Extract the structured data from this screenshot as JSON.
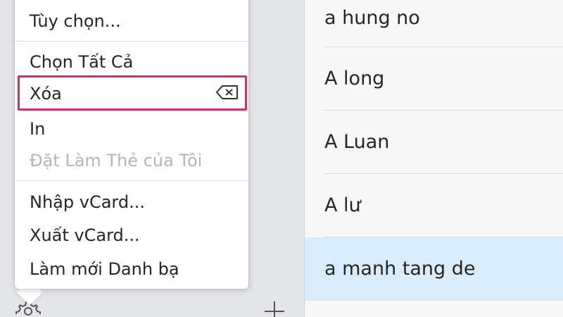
{
  "menu": {
    "items": [
      {
        "label": "Tùy chọn...",
        "enabled": true
      },
      {
        "label": "Chọn Tất Cả",
        "enabled": true
      },
      {
        "label": "Xóa",
        "enabled": true,
        "highlighted": true,
        "shortcut_icon": "delete-key-icon"
      },
      {
        "label": "In",
        "enabled": true
      },
      {
        "label": "Đặt Làm Thẻ của Tôi",
        "enabled": false
      },
      {
        "label": "Nhập vCard...",
        "enabled": true
      },
      {
        "label": "Xuất vCard...",
        "enabled": true
      },
      {
        "label": "Làm mới Danh bạ",
        "enabled": true
      }
    ],
    "highlight_color": "#d1306a"
  },
  "contacts": {
    "items": [
      {
        "name": "a hung no",
        "selected": false
      },
      {
        "name": "A long",
        "selected": false
      },
      {
        "name": "A Luan",
        "selected": false
      },
      {
        "name": "A lư",
        "selected": false
      },
      {
        "name": "a manh tang de",
        "selected": true
      }
    ],
    "selected_color": "#d9ecfb"
  },
  "footer": {
    "icons": [
      "gear-icon",
      "plus-icon"
    ]
  }
}
